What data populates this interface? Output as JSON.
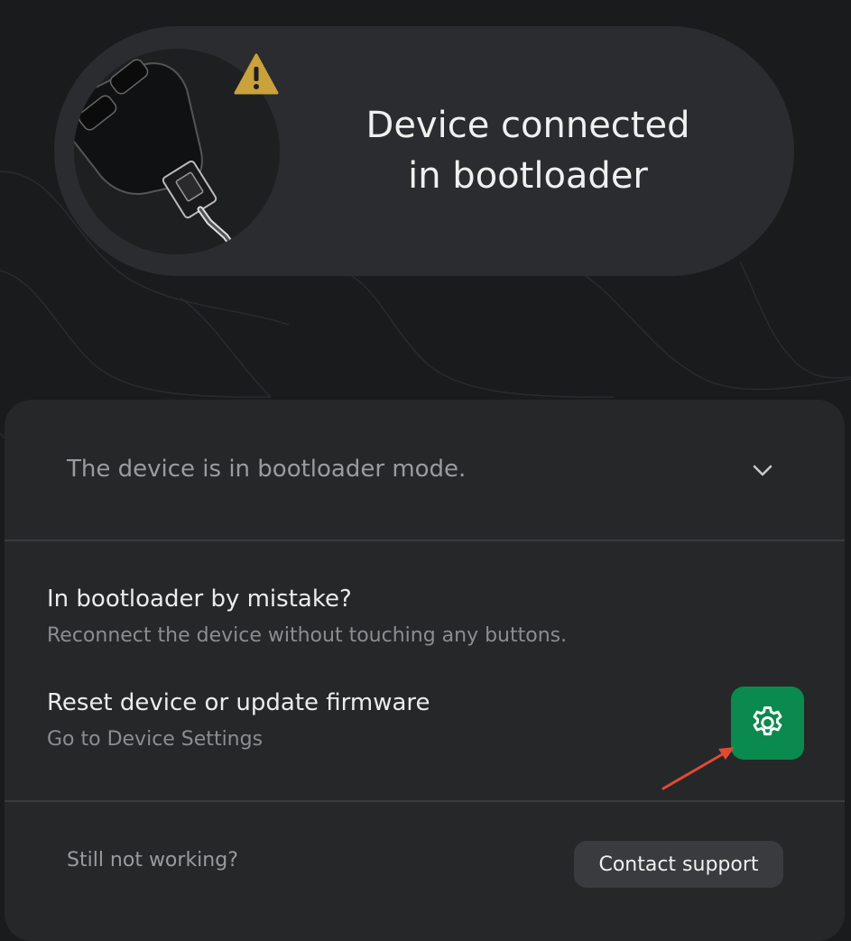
{
  "hero": {
    "title_line1": "Device connected",
    "title_line2": "in bootloader",
    "device_image": "device-usb-illustration",
    "status_icon": "warning-icon"
  },
  "summary": {
    "text": "The device is in bootloader mode.",
    "icon": "chevron-down-icon"
  },
  "rows": [
    {
      "title": "In bootloader by mistake?",
      "subtitle": "Reconnect the device without touching any buttons."
    },
    {
      "title": "Reset device or update firmware",
      "subtitle": "Go to Device Settings",
      "action_icon": "gear-icon"
    }
  ],
  "footer": {
    "prompt": "Still not working?",
    "button_label": "Contact support"
  },
  "colors": {
    "background": "#1a1b1d",
    "card": "#262729",
    "accent_green": "#0a8a4e",
    "warning": "#c9a23b",
    "annotation_arrow": "#e04a34"
  }
}
